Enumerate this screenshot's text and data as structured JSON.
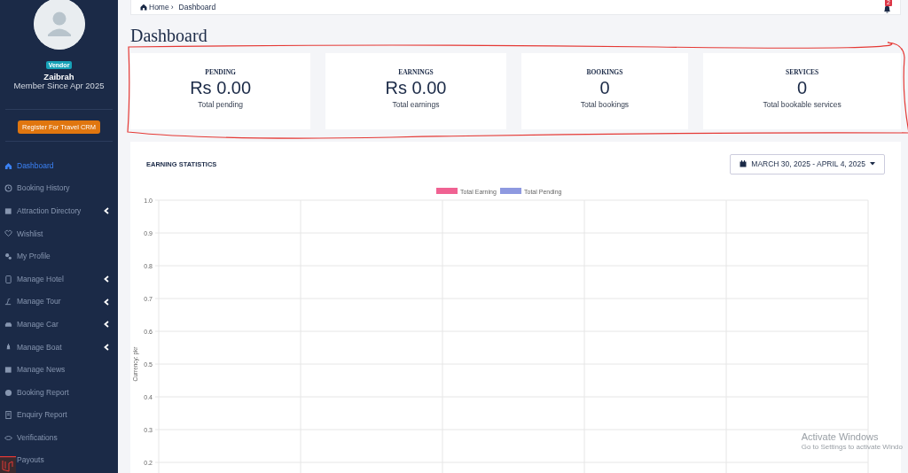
{
  "sidebar": {
    "role_badge": "Vendor",
    "user_name": "Zaibrah",
    "member_since": "Member Since Apr 2025",
    "register_button": "Register For Travel CRM",
    "items": [
      {
        "label": "Dashboard",
        "selected": true,
        "expandable": false
      },
      {
        "label": "Booking History",
        "selected": false,
        "expandable": false
      },
      {
        "label": "Attraction Directory",
        "selected": false,
        "expandable": true
      },
      {
        "label": "Wishlist",
        "selected": false,
        "expandable": false
      },
      {
        "label": "My Profile",
        "selected": false,
        "expandable": false
      },
      {
        "label": "Manage Hotel",
        "selected": false,
        "expandable": true
      },
      {
        "label": "Manage Tour",
        "selected": false,
        "expandable": true
      },
      {
        "label": "Manage Car",
        "selected": false,
        "expandable": true
      },
      {
        "label": "Manage Boat",
        "selected": false,
        "expandable": true
      },
      {
        "label": "Manage News",
        "selected": false,
        "expandable": false
      },
      {
        "label": "Booking Report",
        "selected": false,
        "expandable": false
      },
      {
        "label": "Enquiry Report",
        "selected": false,
        "expandable": false
      },
      {
        "label": "Verifications",
        "selected": false,
        "expandable": false
      },
      {
        "label": "Payouts",
        "selected": false,
        "expandable": false
      }
    ]
  },
  "breadcrumb": [
    {
      "label": "Home"
    },
    {
      "label": "Dashboard"
    }
  ],
  "breadcrumb_separator": "›",
  "notification_count": "2",
  "page_title": "Dashboard",
  "stats": [
    {
      "title": "PENDING",
      "value": "Rs 0.00",
      "caption": "Total pending"
    },
    {
      "title": "EARNINGS",
      "value": "Rs 0.00",
      "caption": "Total earnings"
    },
    {
      "title": "BOOKINGS",
      "value": "0",
      "caption": "Total bookings"
    },
    {
      "title": "SERVICES",
      "value": "0",
      "caption": "Total bookable services"
    }
  ],
  "earning_statistics": {
    "title": "EARNING STATISTICS",
    "date_range": "MARCH 30, 2025 - APRIL 4, 2025",
    "chart_data": {
      "type": "bar",
      "ylabel": "Currency: pkr",
      "ylim": [
        0.2,
        1.0
      ],
      "grid": true,
      "yticks": [
        0.2,
        0.3,
        0.4,
        0.5,
        0.6,
        0.7,
        0.8,
        0.9,
        {
          "value": 1.0,
          "label": "1.0"
        }
      ],
      "series": [
        {
          "name": "Total Earning",
          "color": "#f06292"
        },
        {
          "name": "Total Pending",
          "color": "#8e99e0"
        }
      ]
    }
  },
  "os_notice": {
    "title": "Activate Windows",
    "text": "Go to Settings to activate Windo"
  }
}
